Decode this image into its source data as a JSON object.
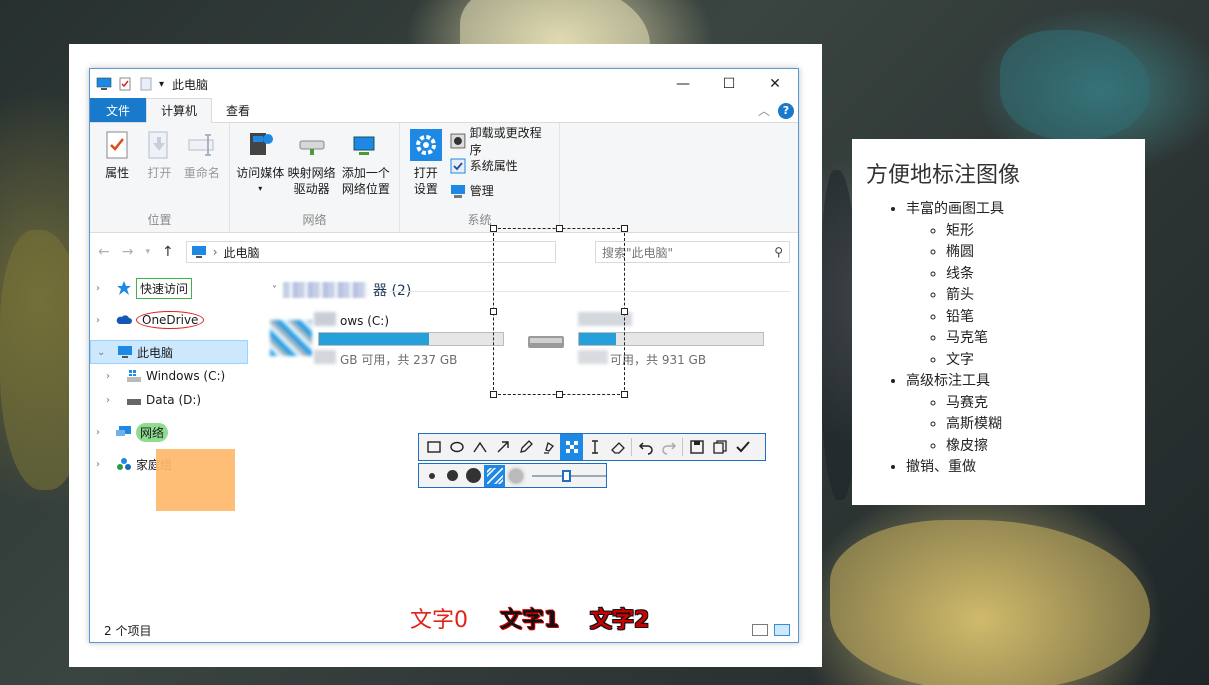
{
  "window": {
    "title": "此电脑",
    "tabs": [
      "文件",
      "计算机",
      "查看"
    ],
    "controls": {
      "minimize": "—",
      "maximize": "☐",
      "close": "✕"
    }
  },
  "ribbon": {
    "groups": [
      {
        "name": "位置",
        "buttons": [
          "属性",
          "打开",
          "重命名"
        ]
      },
      {
        "name": "网络",
        "buttons": [
          "访问媒体",
          "映射网络\n驱动器",
          "添加一个\n网络位置"
        ]
      },
      {
        "name": "系统",
        "big": "打开\n设置",
        "small": [
          "卸载或更改程序",
          "系统属性",
          "管理"
        ]
      }
    ]
  },
  "address": {
    "path": "此电脑",
    "search_placeholder": "搜索\"此电脑\""
  },
  "nav": {
    "items": [
      {
        "label": "快速访问",
        "mark": "green-box"
      },
      {
        "label": "OneDrive",
        "mark": "red-ellipse"
      },
      {
        "label": "此电脑",
        "selected": true
      },
      {
        "label": "Windows (C:)",
        "sub": true
      },
      {
        "label": "Data (D:)",
        "sub": true
      },
      {
        "label": "网络",
        "mark": "green-highlight"
      },
      {
        "label": "家庭组"
      }
    ]
  },
  "content": {
    "section_title": "器 (2)",
    "drives": [
      {
        "name": "ows (C:)",
        "free": "GB 可用，共 237 GB",
        "used_fraction": 0.6
      },
      {
        "name": "",
        "free": "可用，共 931 GB",
        "used_fraction": 0.2
      }
    ]
  },
  "status": {
    "items": "2 个项目"
  },
  "annotations": {
    "text0": "文字0",
    "text1": "文字1",
    "text2": "文字2",
    "mosaic_color": "#ffb86a",
    "selection_color": "#222222"
  },
  "toolbar": {
    "tools": [
      "rectangle-icon",
      "ellipse-icon",
      "polyline-icon",
      "arrow-icon",
      "pencil-icon",
      "marker-icon",
      "mosaic-icon",
      "text-icon",
      "eraser-icon",
      "undo-icon",
      "redo-icon",
      "save-icon",
      "copy-icon",
      "confirm-icon"
    ],
    "active": "mosaic-icon",
    "sizes": [
      "small",
      "medium",
      "large"
    ],
    "accent": "#1e88e5"
  },
  "panel": {
    "title": "方便地标注图像",
    "sections": [
      {
        "label": "丰富的画图工具",
        "items": [
          "矩形",
          "椭圆",
          "线条",
          "箭头",
          "铅笔",
          "马克笔",
          "文字"
        ]
      },
      {
        "label": "高级标注工具",
        "items": [
          "马赛克",
          "高斯模糊",
          "橡皮擦"
        ]
      },
      {
        "label": "撤销、重做",
        "items": []
      }
    ]
  }
}
